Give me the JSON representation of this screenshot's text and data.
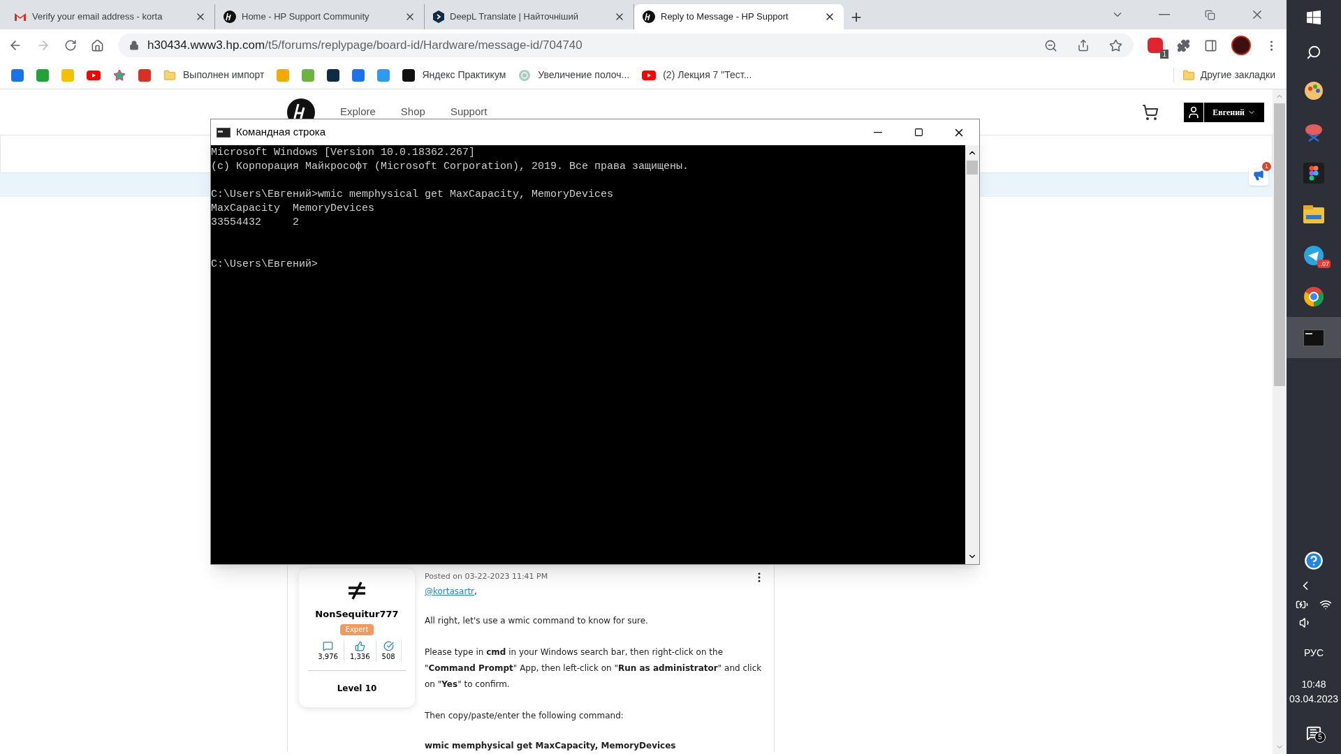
{
  "browser": {
    "tabs": [
      {
        "title": "Verify your email address - korta",
        "selected": false
      },
      {
        "title": "Home - HP Support Community",
        "selected": false
      },
      {
        "title": "DeepL Translate | Найточніший",
        "selected": false
      },
      {
        "title": "Reply to Message - HP Support",
        "selected": true
      }
    ],
    "new_tab": "+",
    "url_host": "h30434.www3.hp.com",
    "url_path": "/t5/forums/replypage/board-id/Hardware/message-id/704740",
    "adblock_badge": "1",
    "bookmarks": [
      {
        "kind": "icon"
      },
      {
        "kind": "icon"
      },
      {
        "kind": "icon"
      },
      {
        "kind": "icon"
      },
      {
        "kind": "icon"
      },
      {
        "kind": "icon"
      },
      {
        "kind": "link",
        "label": "Выполнен импорт"
      },
      {
        "kind": "icon"
      },
      {
        "kind": "icon"
      },
      {
        "kind": "icon"
      },
      {
        "kind": "icon"
      },
      {
        "kind": "icon"
      },
      {
        "kind": "link",
        "label": "Яндекс Практикум"
      },
      {
        "kind": "link",
        "label": "Увеличение полоч..."
      },
      {
        "kind": "link",
        "label": "(2) Лекция 7 \"Тест..."
      }
    ],
    "other_bookmarks": "Другие закладки"
  },
  "site": {
    "nav": [
      "Explore",
      "Shop",
      "Support"
    ],
    "user": "Евгений",
    "feedback_badge": "1"
  },
  "console": {
    "title": "Командная строка",
    "blocks": [
      {
        "kind": "banner",
        "lines": [
          "Microsoft Windows [Version 10.0.18362.267]",
          "(c) Корпорация Майкрософт (Microsoft Corporation), 2019. Все права защищены."
        ]
      },
      {
        "kind": "output",
        "lines": [
          "C:\\Users\\Евгений>wmic memphysical get MaxCapacity, MemoryDevices",
          "MaxCapacity  MemoryDevices",
          "33554432     2"
        ]
      },
      {
        "kind": "prompt",
        "lines": [
          "C:\\Users\\Евгений>"
        ]
      }
    ]
  },
  "post": {
    "author": "NonSequitur777",
    "rank": "Expert",
    "stats": [
      "3,976",
      "1,336",
      "508"
    ],
    "level": "Level 10",
    "posted": "Posted on 03-22-2023 11:41 PM",
    "mention": "@kortasartr",
    "mention_suffix": ",",
    "paragraphs": [
      "All right, let's use a wmic command to know for sure.",
      "Please type in **cmd** in your Windows search bar, then right-click on the \"**Command Prompt**\" App, then left-click on \"**Run as administrator**\" and click on \"**Yes**\" to confirm.",
      "Then copy/paste/enter the following command:"
    ],
    "command": "wmic memphysical get MaxCapacity, MemoryDevices"
  },
  "taskbar": {
    "apps": [
      {
        "selected": false
      },
      {
        "selected": false
      },
      {
        "selected": false
      },
      {
        "selected": false
      },
      {
        "selected": false
      },
      {
        "selected": false
      },
      {
        "selected": true
      }
    ],
    "telegram_badge": "..07",
    "language": "РУС",
    "time": "10:48",
    "date": "03.04.2023",
    "notifications": "5"
  }
}
